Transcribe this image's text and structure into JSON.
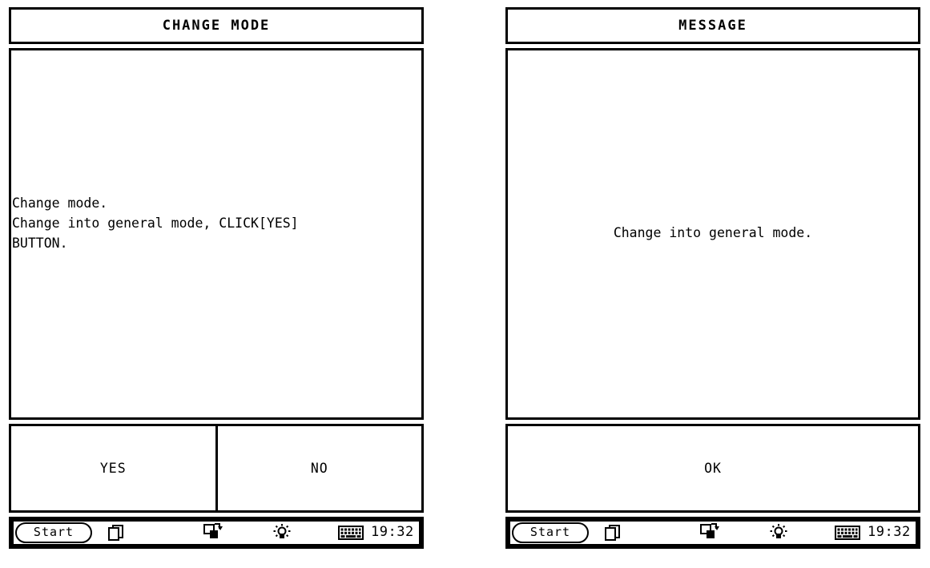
{
  "panels": [
    {
      "id": "change-mode",
      "title": "CHANGE MODE",
      "body_text": "Change mode.\nChange into general mode, CLICK[YES]\nBUTTON.",
      "body_align": "left",
      "buttons": [
        {
          "label": "YES"
        },
        {
          "label": "NO"
        }
      ],
      "taskbar": {
        "start_label": "Start",
        "clock": "19:32",
        "icons": [
          "windows-stack-icon",
          "rotate-icon",
          "brightness-icon",
          "keyboard-icon"
        ]
      }
    },
    {
      "id": "message",
      "title": "MESSAGE",
      "body_text": "Change into general mode.",
      "body_align": "center",
      "buttons": [
        {
          "label": "OK"
        }
      ],
      "taskbar": {
        "start_label": "Start",
        "clock": "19:32",
        "icons": [
          "windows-stack-icon",
          "rotate-icon",
          "brightness-icon",
          "keyboard-icon"
        ]
      }
    }
  ],
  "colors": {
    "foreground": "#000000",
    "background": "#ffffff"
  }
}
